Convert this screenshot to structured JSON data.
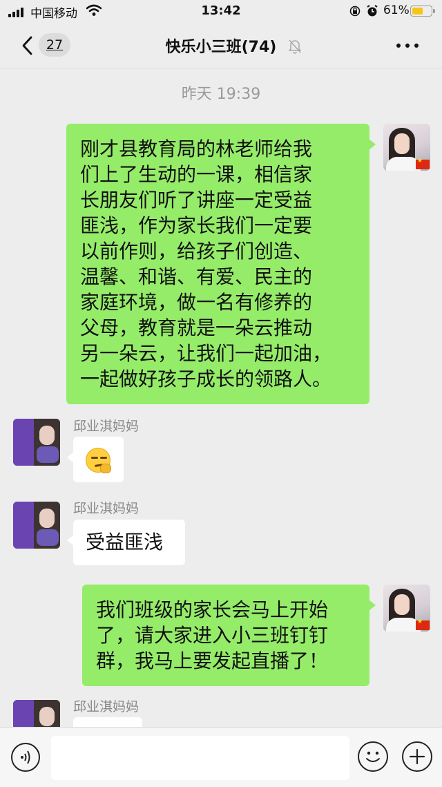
{
  "status_bar": {
    "carrier": "中国移动",
    "time": "13:42",
    "battery_percent": "61%",
    "battery_level": 0.61
  },
  "nav": {
    "unread_count": "27",
    "title": "快乐小三班(74)"
  },
  "chat": {
    "timestamp": "昨天 19:39",
    "messages": [
      {
        "direction": "outgoing",
        "text_lines": [
          "刚才县教育局的林老师给我",
          "们上了生动的一课，相信家",
          "长朋友们听了讲座一定受益",
          "匪浅，作为家长我们一定要",
          "以前作则，给孩子们创造、",
          "温馨、和谐、有爱、民主的",
          "家庭环境，做一名有修养的",
          "父母，教育就是一朵云推动",
          "另一朵云，让我们一起加油，",
          "一起做好孩子成长的领路人。"
        ]
      },
      {
        "direction": "incoming",
        "sender": "邱业淇妈妈",
        "content_type": "emoji",
        "emoji": "smirking-face-with-hand"
      },
      {
        "direction": "incoming",
        "sender": "邱业淇妈妈",
        "text": "受益匪浅"
      },
      {
        "direction": "outgoing",
        "text_lines": [
          "我们班级的家长会马上开始",
          "了，请大家进入小三班钉钉",
          "群，我马上要发起直播了！"
        ]
      },
      {
        "direction": "incoming",
        "sender": "邱业淇妈妈",
        "content_type": "partial"
      }
    ]
  },
  "icons": {
    "back": "chevron-left-icon",
    "mute": "bell-off-icon",
    "more": "more-dots-icon",
    "voice": "voice-icon",
    "emoji": "smile-icon",
    "plus": "plus-icon"
  },
  "colors": {
    "outgoing_bubble": "#95ec69",
    "incoming_bubble": "#ffffff",
    "background": "#ededed"
  }
}
